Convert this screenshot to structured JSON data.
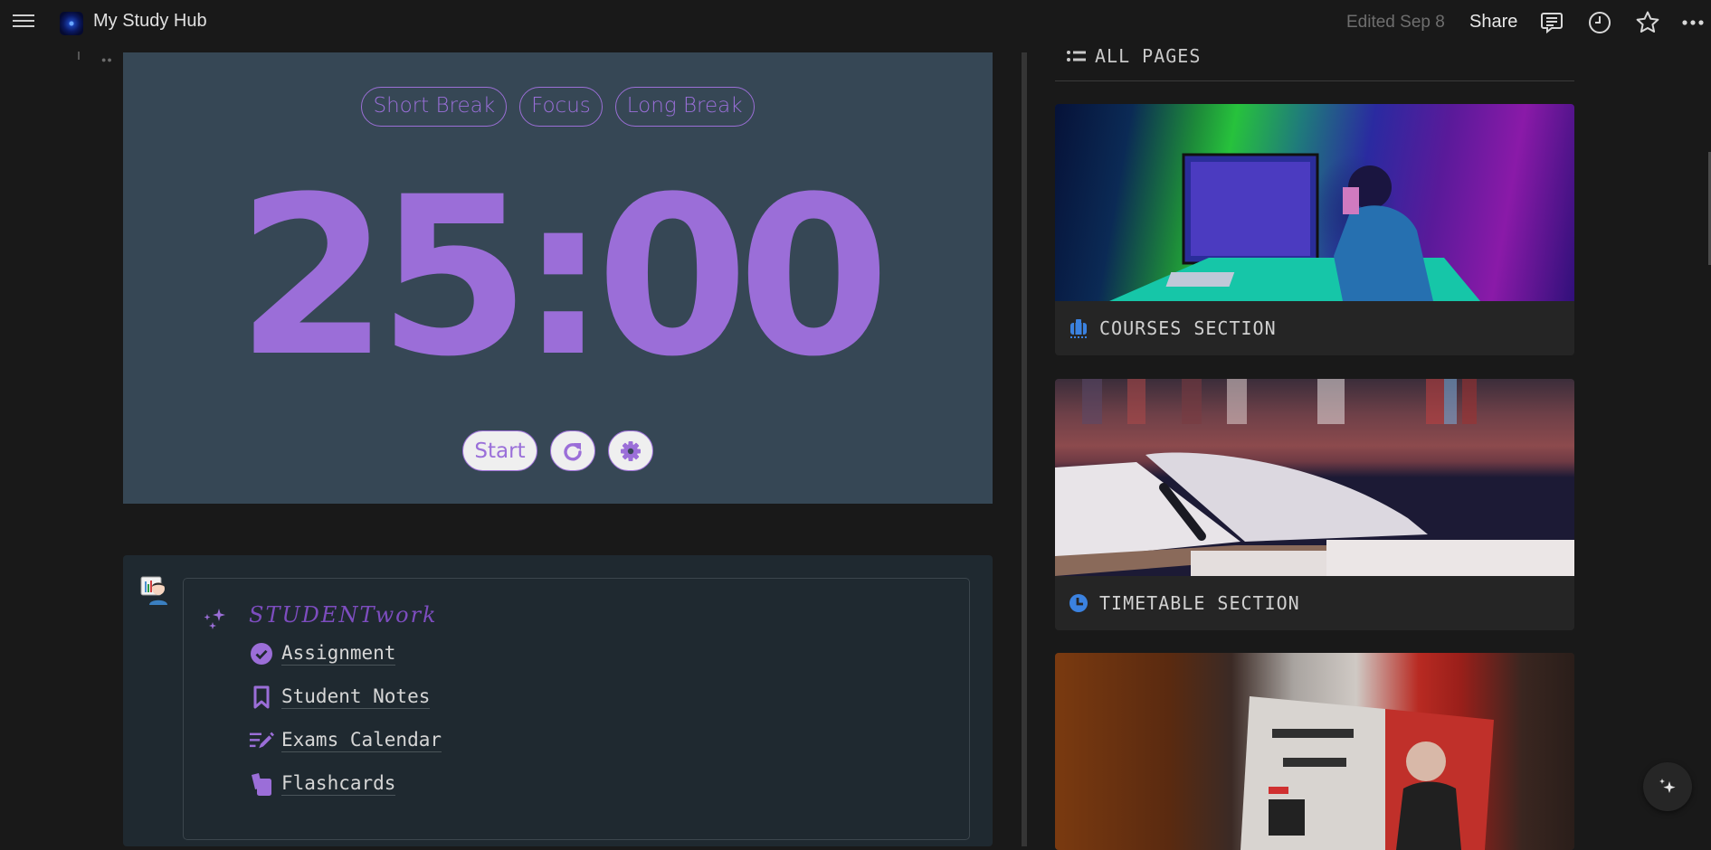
{
  "topbar": {
    "title": "My Study Hub",
    "edited": "Edited Sep 8",
    "share": "Share",
    "icons": [
      "menu-icon",
      "comments-icon",
      "history-clock-icon",
      "favorite-star-icon",
      "more-icon"
    ]
  },
  "pomodoro": {
    "modes": [
      "Short Break",
      "Focus",
      "Long Break"
    ],
    "time": "25:00",
    "start_label": "Start",
    "reset_icon": "reset-icon",
    "settings_icon": "gear-icon",
    "accent": "#9b6ed8",
    "background": "#364755"
  },
  "student": {
    "title": "STUDENTwork",
    "links": [
      {
        "label": "Assignment",
        "icon": "check-circle-icon"
      },
      {
        "label": "Student Notes",
        "icon": "bookmark-icon"
      },
      {
        "label": "Exams Calendar",
        "icon": "edit-list-icon"
      },
      {
        "label": "Flashcards",
        "icon": "cards-icon"
      }
    ]
  },
  "all_pages": {
    "heading": "ALL PAGES",
    "cards": [
      {
        "label": "COURSES SECTION",
        "icon": "briefcase-icon",
        "image": "coder-at-computer-illustration"
      },
      {
        "label": "TIMETABLE SECTION",
        "icon": "clock-icon",
        "image": "open-book-with-pen-photo"
      },
      {
        "label": "",
        "icon": "",
        "image": "person-reading-magazine-photo"
      }
    ]
  },
  "ai_button": {
    "icon": "sparkle-icon"
  }
}
